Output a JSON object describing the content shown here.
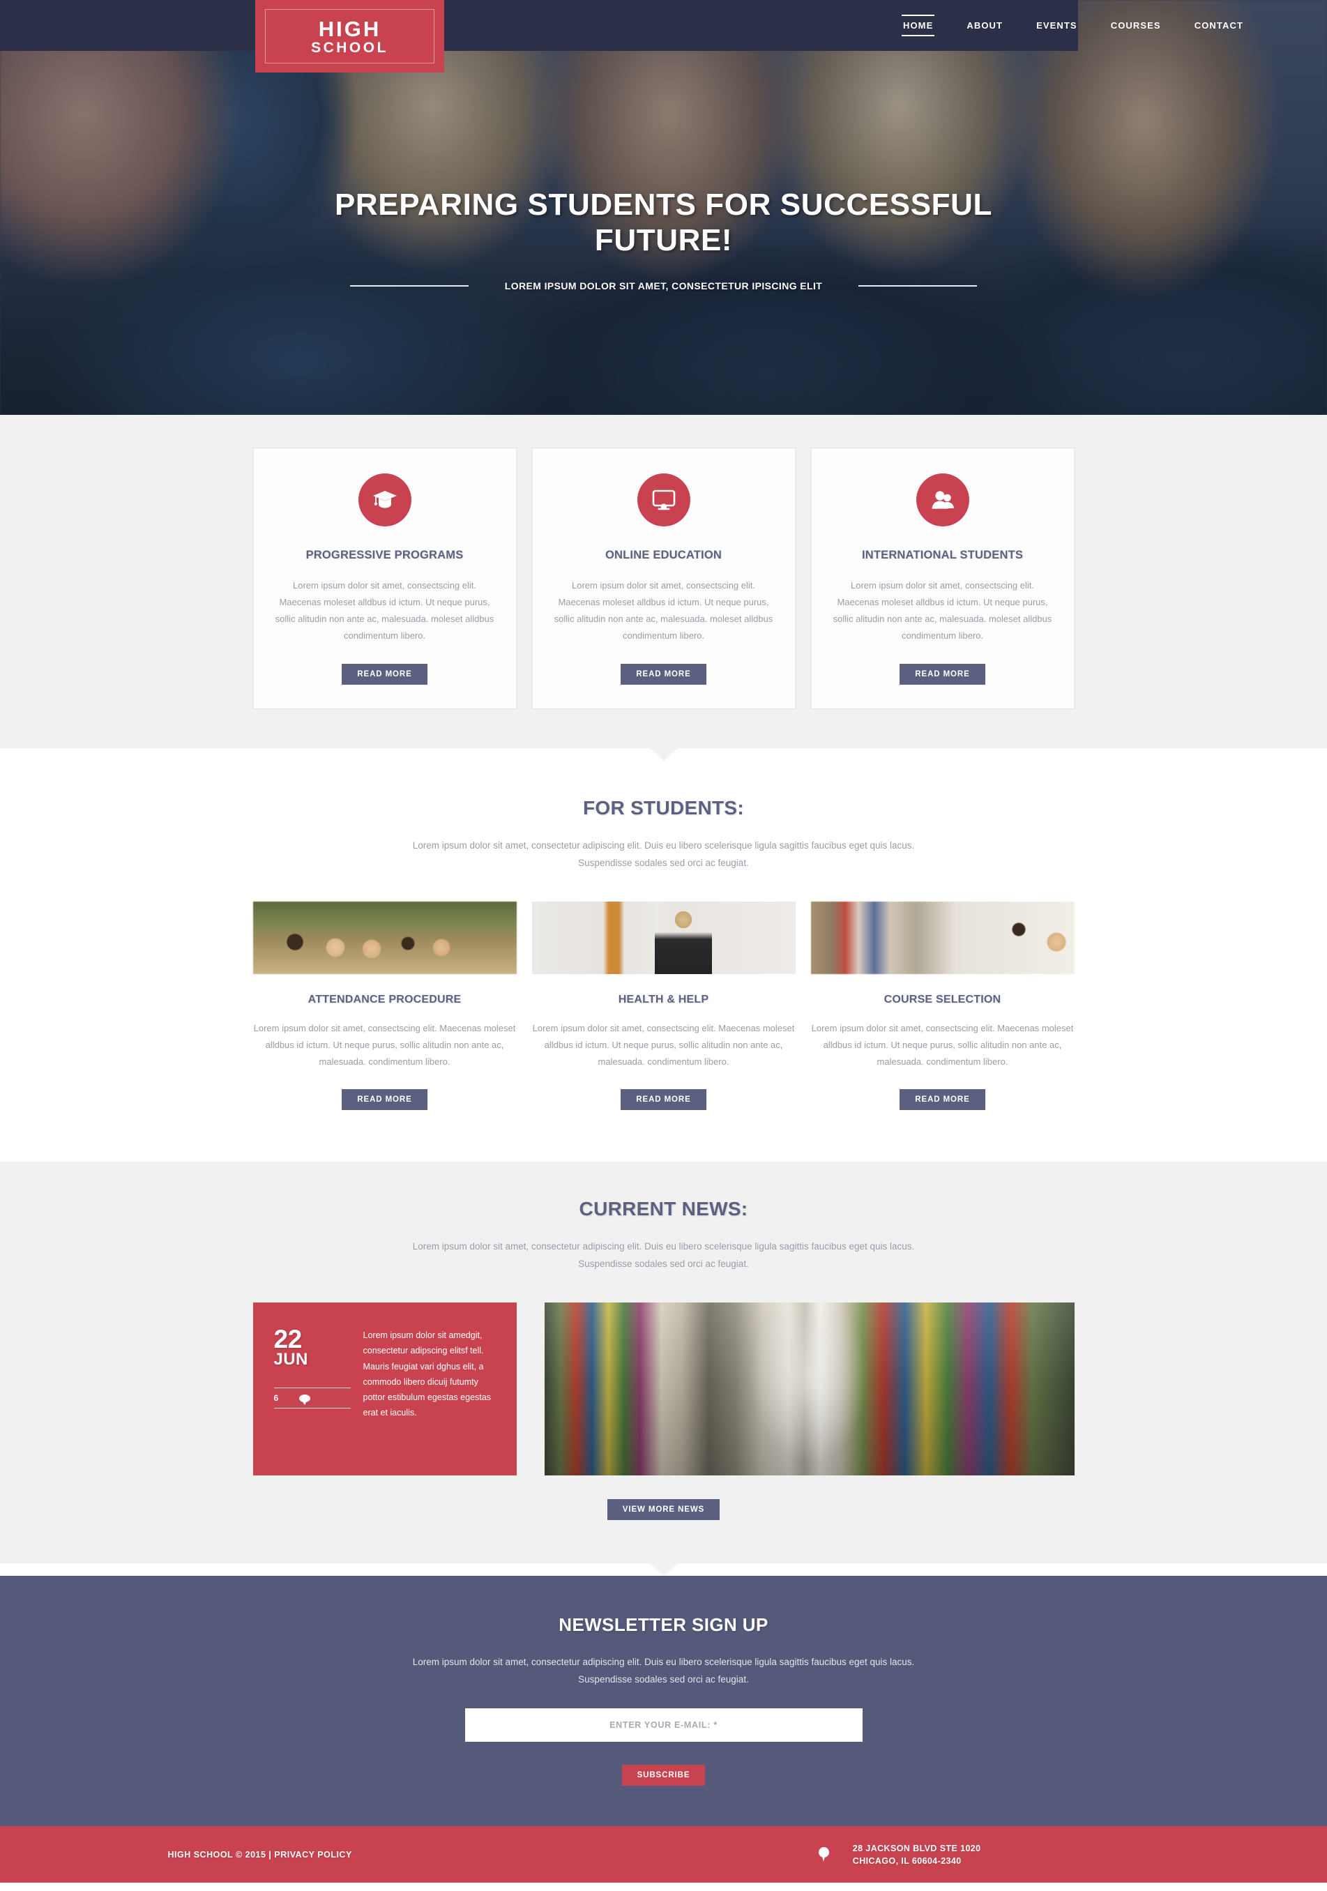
{
  "brand": {
    "logo_top": "HIGH",
    "logo_bottom": "SCHOOL",
    "accent_red": "#c8434f",
    "accent_navy": "#2b3048",
    "accent_slate": "#555a7a"
  },
  "nav": {
    "items": [
      {
        "label": "HOME",
        "active": true
      },
      {
        "label": "ABOUT",
        "active": false
      },
      {
        "label": "EVENTS",
        "active": false
      },
      {
        "label": "COURSES",
        "active": false
      },
      {
        "label": "CONTACT",
        "active": false
      }
    ]
  },
  "hero": {
    "title": "PREPARING STUDENTS FOR SUCCESSFUL FUTURE!",
    "subtitle": "LOREM IPSUM DOLOR SIT AMET, CONSECTETUR IPISCING ELIT"
  },
  "features": {
    "cards": [
      {
        "icon": "graduation-cap-icon",
        "title": "PROGRESSIVE PROGRAMS",
        "text": "Lorem ipsum dolor sit amet, consectscing elit. Maecenas moleset alldbus id ictum. Ut neque purus, sollic alitudin non ante ac, malesuada. moleset alldbus condimentum libero.",
        "button": "READ MORE"
      },
      {
        "icon": "monitor-icon",
        "title": "ONLINE EDUCATION",
        "text": "Lorem ipsum dolor sit amet, consectscing elit. Maecenas moleset alldbus id ictum. Ut neque purus, sollic alitudin non ante ac, malesuada. moleset alldbus condimentum libero.",
        "button": "READ MORE"
      },
      {
        "icon": "people-icon",
        "title": "INTERNATIONAL STUDENTS",
        "text": "Lorem ipsum dolor sit amet, consectscing elit. Maecenas moleset alldbus id ictum. Ut neque purus, sollic alitudin non ante ac, malesuada. moleset alldbus condimentum libero.",
        "button": "READ MORE"
      }
    ]
  },
  "students": {
    "title": "FOR STUDENTS:",
    "description": "Lorem ipsum dolor sit amet, consectetur adipiscing elit. Duis eu libero scelerisque ligula sagittis faucibus eget quis lacus. Suspendisse sodales sed orci ac feugiat.",
    "cards": [
      {
        "photo": "students-group-photo",
        "title": "ATTENDANCE PROCEDURE",
        "text": "Lorem ipsum dolor sit amet, consectscing elit. Maecenas moleset alldbus id ictum. Ut neque purus, sollic alitudin non ante ac, malesuada. condimentum libero.",
        "button": "READ MORE"
      },
      {
        "photo": "student-lockers-photo",
        "title": "HEALTH & HELP",
        "text": "Lorem ipsum dolor sit amet, consectscing elit. Maecenas moleset alldbus id ictum. Ut neque purus, sollic alitudin non ante ac, malesuada. condimentum libero.",
        "button": "READ MORE"
      },
      {
        "photo": "library-couple-photo",
        "title": "COURSE SELECTION",
        "text": "Lorem ipsum dolor sit amet, consectscing elit. Maecenas moleset alldbus id ictum. Ut neque purus, sollic alitudin non ante ac, malesuada. condimentum libero.",
        "button": "READ MORE"
      }
    ]
  },
  "news": {
    "title": "CURRENT NEWS:",
    "description": "Lorem ipsum dolor sit amet, consectetur adipiscing elit. Duis eu libero scelerisque ligula sagittis faucibus eget quis lacus. Suspendisse sodales sed orci ac feugiat.",
    "item": {
      "day": "22",
      "month": "JUN",
      "comment_count": "6",
      "text": "Lorem ipsum dolor sit amedgit, consectetur adipscing elitsf tell. Mauris feugiat vari dghus elit, a commodo libero dicuij futumty pottor estibulum   egestas egestas erat et iaculis.",
      "photo": "library-shelves-photo"
    },
    "view_more_button": "VIEW MORE NEWS"
  },
  "newsletter": {
    "title": "NEWSLETTER SIGN UP",
    "description": "Lorem ipsum dolor sit amet, consectetur adipiscing elit. Duis eu libero scelerisque ligula sagittis faucibus eget quis lacus. Suspendisse sodales sed orci ac feugiat.",
    "email_placeholder": "ENTER YOUR E-MAIL: *",
    "email_value": "",
    "subscribe_button": "SUBSCRIBE"
  },
  "footer": {
    "copyright": "HIGH SCHOOL © 2015 | PRIVACY POLICY",
    "address_line1": "28 JACKSON BLVD STE 1020",
    "address_line2": "CHICAGO, IL 60604-2340"
  }
}
